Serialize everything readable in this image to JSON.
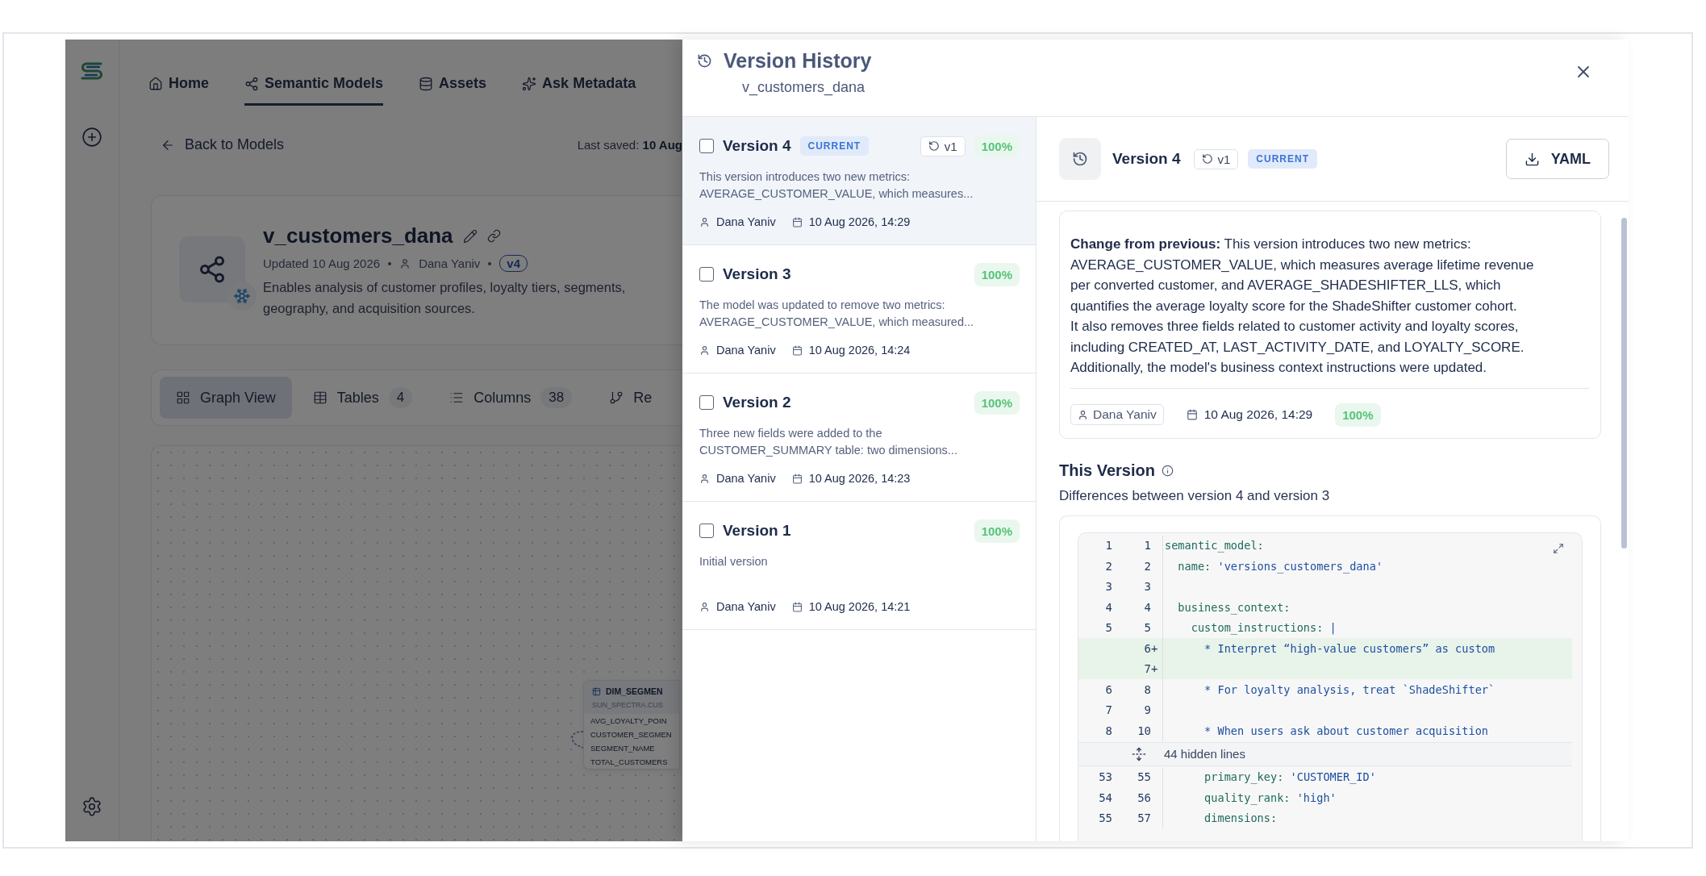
{
  "app": {
    "nav": [
      {
        "label": "Home",
        "selected": false
      },
      {
        "label": "Semantic Models",
        "selected": true
      },
      {
        "label": "Assets",
        "selected": false
      },
      {
        "label": "Ask Metadata",
        "selected": false
      }
    ],
    "back_link": "Back to Models",
    "last_saved": {
      "label": "Last saved:",
      "value": "10 Aug"
    },
    "model": {
      "name": "v_customers_dana",
      "updated": "Updated 10 Aug 2026",
      "author": "Dana Yaniv",
      "version": "v4",
      "description_lines": [
        "Enables analysis of customer profiles, loyalty tiers, segments,",
        "geography, and acquisition sources."
      ]
    },
    "tabs": [
      {
        "label": "Graph View",
        "selected": true
      },
      {
        "label": "Tables",
        "count": "4",
        "selected": false
      },
      {
        "label": "Columns",
        "count": "38",
        "selected": false
      },
      {
        "label": "Re",
        "selected": false
      }
    ],
    "graph_node": {
      "title": "DIM_SEGMEN",
      "subtitle": "SUN_SPECTRA.CUS",
      "fields": [
        "AVG_LOYALTY_POIN",
        "CUSTOMER_SEGMEN",
        "SEGMENT_NAME",
        "TOTAL_CUSTOMERS"
      ]
    }
  },
  "drawer": {
    "title": "Version History",
    "subtitle": "v_customers_dana",
    "versions": [
      {
        "title": "Version 4",
        "badge": "CURRENT",
        "revert": "v1",
        "score": "100%",
        "summary_lines": [
          "This version introduces two new metrics:",
          "AVERAGE_CUSTOMER_VALUE, which measures..."
        ],
        "author": "Dana Yaniv",
        "date": "10 Aug 2026, 14:29",
        "selected": true,
        "checked": false
      },
      {
        "title": "Version 3",
        "score": "100%",
        "summary_lines": [
          "The model was updated to remove two metrics:",
          "AVERAGE_CUSTOMER_VALUE, which measured..."
        ],
        "author": "Dana Yaniv",
        "date": "10 Aug 2026, 14:24",
        "selected": false,
        "checked": false
      },
      {
        "title": "Version 2",
        "score": "100%",
        "summary_lines": [
          "Three new fields were added to the",
          "CUSTOMER_SUMMARY table: two dimensions..."
        ],
        "author": "Dana Yaniv",
        "date": "10 Aug 2026, 14:23",
        "selected": false,
        "checked": false
      },
      {
        "title": "Version 1",
        "score": "100%",
        "summary_lines": [
          "Initial version"
        ],
        "author": "Dana Yaniv",
        "date": "10 Aug 2026, 14:21",
        "selected": false,
        "checked": false
      }
    ],
    "detail": {
      "title": "Version 4",
      "revert": "v1",
      "badge": "CURRENT",
      "download": "YAML",
      "description_lines": [
        "**Change from previous:** This version introduces two new metrics:",
        "AVERAGE_CUSTOMER_VALUE, which measures average lifetime revenue",
        "per converted customer, and AVERAGE_SHADESHIFTER_LLS, which",
        "quantifies the average loyalty score for the ShadeShifter customer cohort.",
        "It also removes three fields related to customer activity and loyalty scores,",
        "including CREATED_AT, LAST_ACTIVITY_DATE, and LOYALTY_SCORE.",
        "Additionally, the model's business context instructions were updated."
      ],
      "author": "Dana Yaniv",
      "date": "10 Aug 2026, 14:29",
      "score": "100%",
      "section_title": "This Version",
      "section_subtitle": "Differences between version 4 and version 3",
      "diff": [
        {
          "kind": "context",
          "old": "1",
          "new": "1",
          "key": "semantic_model:"
        },
        {
          "kind": "context",
          "old": "2",
          "new": "2",
          "key": "  name:",
          "value": " 'versions_customers_dana'"
        },
        {
          "kind": "context",
          "old": "3",
          "new": "3"
        },
        {
          "kind": "context",
          "old": "4",
          "new": "4",
          "key": "  business_context:"
        },
        {
          "kind": "context",
          "old": "5",
          "new": "5",
          "key": "    custom_instructions:",
          "value": " |"
        },
        {
          "kind": "added",
          "new": "6",
          "marker": "+",
          "value": "      * Interpret “high-value customers” as custom"
        },
        {
          "kind": "added",
          "new": "7",
          "marker": "+"
        },
        {
          "kind": "context",
          "old": "6",
          "new": "8",
          "value": "      * For loyalty analysis, treat `ShadeShifter`"
        },
        {
          "kind": "context",
          "old": "7",
          "new": "9"
        },
        {
          "kind": "context",
          "old": "8",
          "new": "10",
          "value": "      * When users ask about customer acquisition"
        },
        {
          "kind": "hidden",
          "label": "44 hidden lines"
        },
        {
          "kind": "context",
          "old": "53",
          "new": "55",
          "key": "      primary_key:",
          "value": " 'CUSTOMER_ID'"
        },
        {
          "kind": "context",
          "old": "54",
          "new": "56",
          "key": "      quality_rank:",
          "value": " 'high'"
        },
        {
          "kind": "context",
          "old": "55",
          "new": "57",
          "key": "      dimensions:"
        }
      ]
    }
  }
}
